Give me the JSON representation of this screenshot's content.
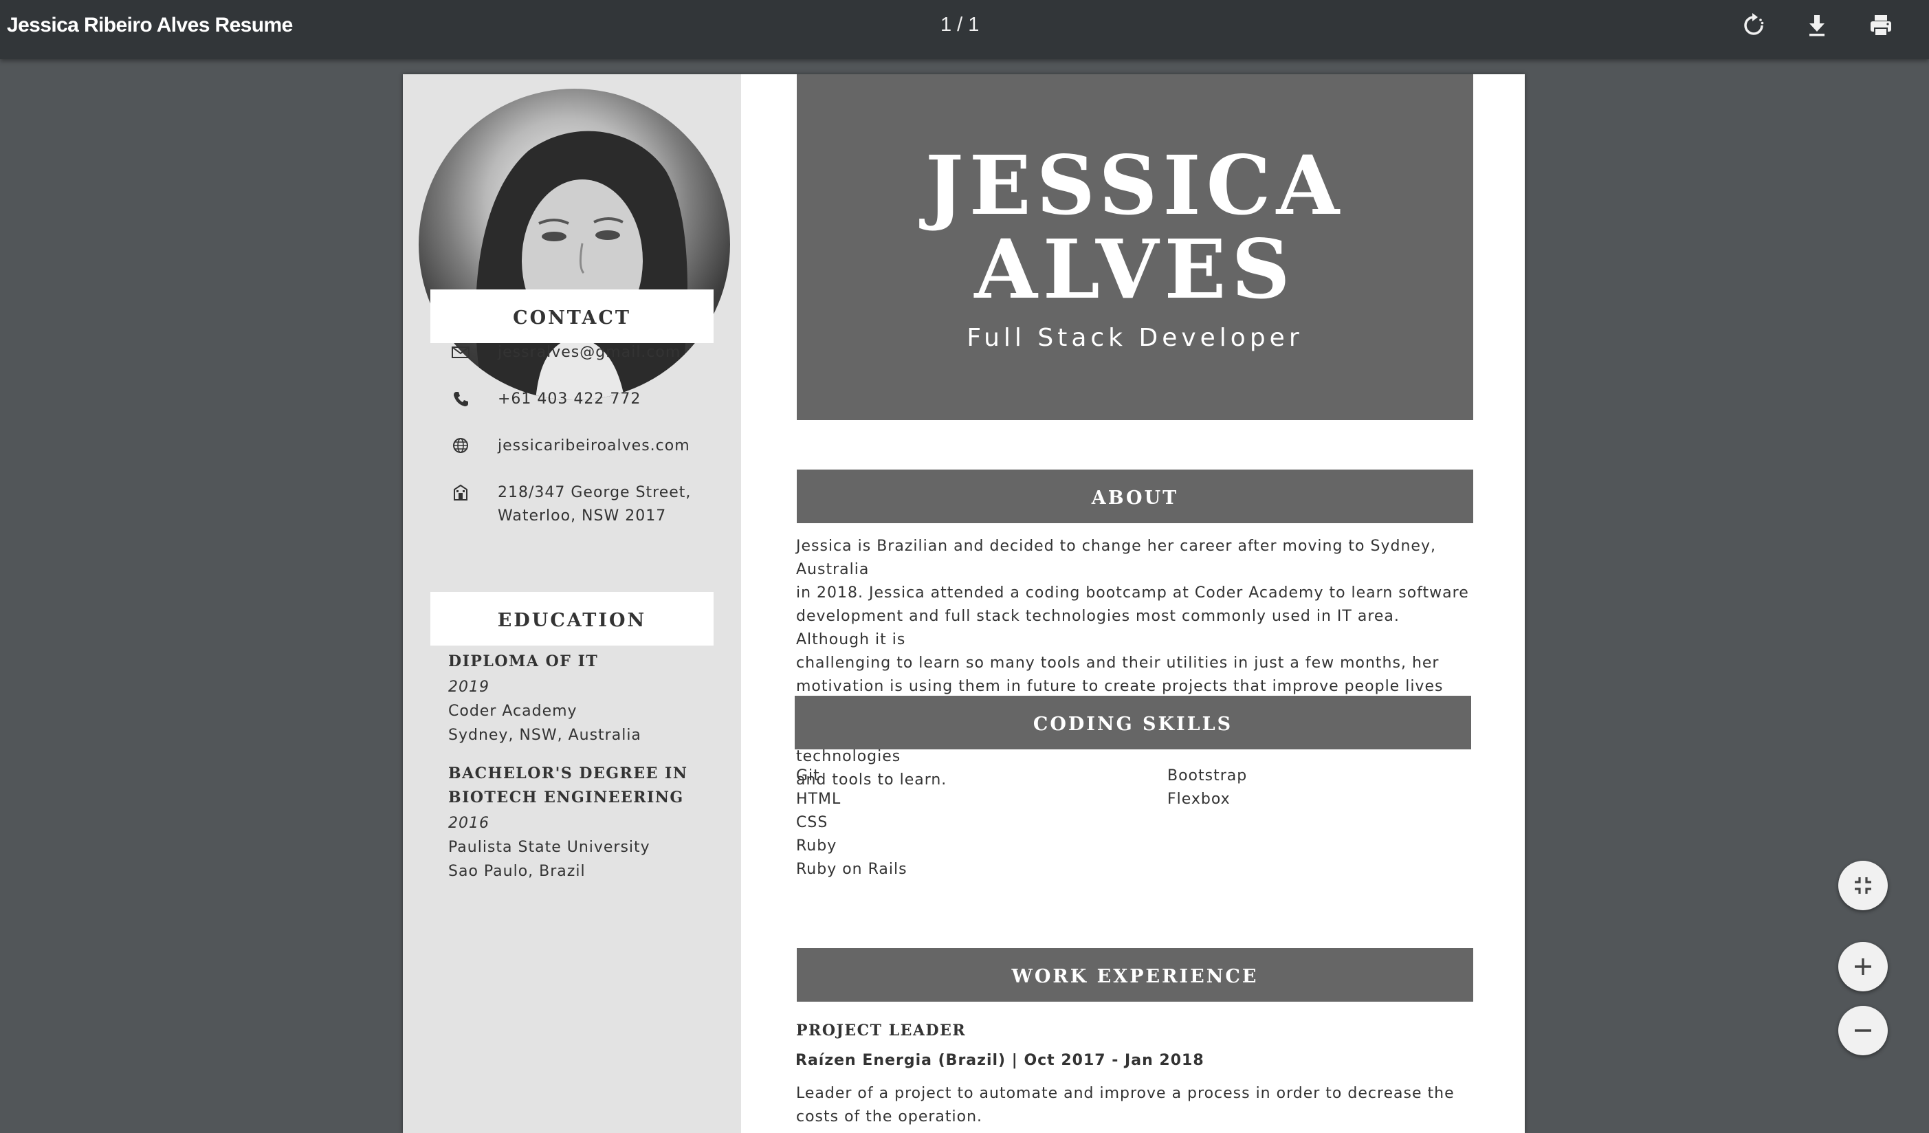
{
  "toolbar": {
    "title": "Jessica Ribeiro Alves Resume",
    "page_counter": "1 / 1",
    "rotate_icon": "rotate-icon",
    "download_icon": "download-icon",
    "print_icon": "print-icon"
  },
  "resume": {
    "first_name": "JESSICA",
    "last_name": "ALVES",
    "role": "Full Stack Developer",
    "photo_icon": "profile-photo",
    "contact": {
      "heading": "CONTACT",
      "email": "jessralves@gmail.com",
      "phone": "+61 403 422 772",
      "website": "jessicaribeiroalves.com",
      "address_line1": "218/347 George Street,",
      "address_line2": "Waterloo, NSW 2017"
    },
    "education": {
      "heading": "EDUCATION",
      "items": [
        {
          "degree": "DIPLOMA OF IT",
          "year": "2019",
          "school": "Coder Academy",
          "location": "Sydney, NSW, Australia"
        },
        {
          "degree_line1": "BACHELOR'S DEGREE IN",
          "degree_line2": "BIOTECH ENGINEERING",
          "year": "2016",
          "school": "Paulista State University",
          "location": "Sao Paulo, Brazil"
        }
      ]
    },
    "about": {
      "heading": "ABOUT",
      "lines": [
        "Jessica is Brazilian and decided to change her career after moving to Sydney, Australia",
        "in 2018. Jessica attended a coding bootcamp at Coder Academy to learn software",
        "development and full stack technologies most commonly used in IT area. Although it is",
        "challenging to learn so many tools and their utilities in just a few months, her",
        "motivation is using them in future to create projects that improve people lives and",
        "knowing that even after much learning, there will always be many other technologies",
        "and tools to learn."
      ]
    },
    "skills": {
      "heading": "CODING SKILLS",
      "col1": [
        "Git",
        "HTML",
        "CSS",
        "Ruby",
        "Ruby on Rails"
      ],
      "col2": [
        "Bootstrap",
        "Flexbox"
      ]
    },
    "work": {
      "heading": "WORK EXPERIENCE",
      "title": "PROJECT LEADER",
      "company": "Raízen Energia (Brazil) | Oct 2017 - Jan 2018",
      "description": "Leader of a project to automate and improve a process in order to decrease the costs of the operation."
    }
  },
  "zoom_controls": {
    "fit_icon": "fit-to-page-icon",
    "zoom_in_icon": "plus-icon",
    "zoom_out_icon": "minus-icon"
  }
}
